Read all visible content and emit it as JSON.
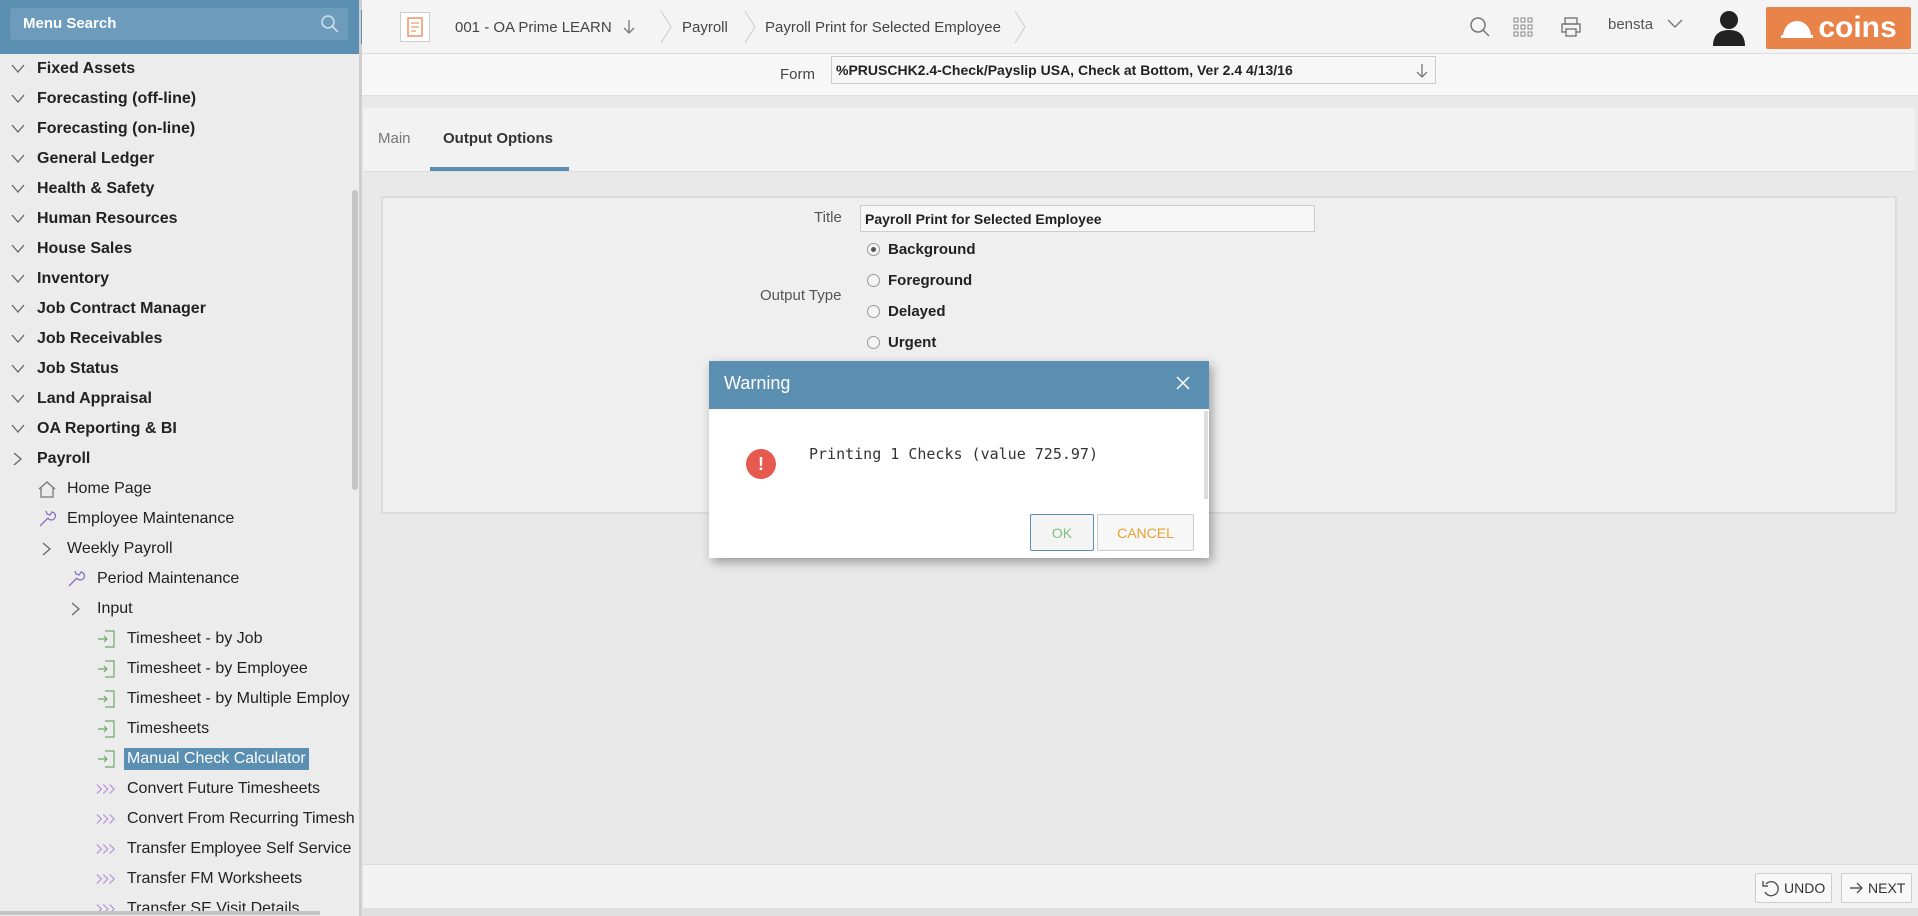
{
  "sidebar": {
    "search_label": "Menu Search",
    "items": [
      {
        "label": "Fixed Assets",
        "level": 0,
        "icon": "chevron-down"
      },
      {
        "label": "Forecasting (off-line)",
        "level": 0,
        "icon": "chevron-down"
      },
      {
        "label": "Forecasting (on-line)",
        "level": 0,
        "icon": "chevron-down"
      },
      {
        "label": "General Ledger",
        "level": 0,
        "icon": "chevron-down"
      },
      {
        "label": "Health & Safety",
        "level": 0,
        "icon": "chevron-down"
      },
      {
        "label": "Human Resources",
        "level": 0,
        "icon": "chevron-down"
      },
      {
        "label": "House Sales",
        "level": 0,
        "icon": "chevron-down"
      },
      {
        "label": "Inventory",
        "level": 0,
        "icon": "chevron-down"
      },
      {
        "label": "Job Contract Manager",
        "level": 0,
        "icon": "chevron-down"
      },
      {
        "label": "Job Receivables",
        "level": 0,
        "icon": "chevron-down"
      },
      {
        "label": "Job Status",
        "level": 0,
        "icon": "chevron-down"
      },
      {
        "label": "Land Appraisal",
        "level": 0,
        "icon": "chevron-down"
      },
      {
        "label": "OA Reporting & BI",
        "level": 0,
        "icon": "chevron-down"
      },
      {
        "label": "Payroll",
        "level": 0,
        "icon": "chevron-right"
      },
      {
        "label": "Home Page",
        "level": 1,
        "icon": "home"
      },
      {
        "label": "Employee Maintenance",
        "level": 1,
        "icon": "wrench"
      },
      {
        "label": "Weekly Payroll",
        "level": 1,
        "icon": "chevron-right"
      },
      {
        "label": "Period Maintenance",
        "level": 2,
        "icon": "wrench"
      },
      {
        "label": "Input",
        "level": 2,
        "icon": "chevron-right"
      },
      {
        "label": "Timesheet - by Job",
        "level": 3,
        "icon": "form"
      },
      {
        "label": "Timesheet - by Employee",
        "level": 3,
        "icon": "form"
      },
      {
        "label": "Timesheet - by Multiple Employ",
        "level": 3,
        "icon": "form"
      },
      {
        "label": "Timesheets",
        "level": 3,
        "icon": "form"
      },
      {
        "label": "Manual Check Calculator",
        "level": 3,
        "icon": "form",
        "selected": true
      },
      {
        "label": "Convert Future Timesheets",
        "level": 3,
        "icon": "process"
      },
      {
        "label": "Convert From Recurring Timesh",
        "level": 3,
        "icon": "process"
      },
      {
        "label": "Transfer Employee Self Service",
        "level": 3,
        "icon": "process"
      },
      {
        "label": "Transfer FM Worksheets",
        "level": 3,
        "icon": "process"
      },
      {
        "label": "Transfer SE Visit Details",
        "level": 3,
        "icon": "process"
      }
    ]
  },
  "topbar": {
    "company": "001 - OA Prime LEARN",
    "module": "Payroll",
    "page": "Payroll Print for Selected Employee",
    "username": "bensta",
    "logo_text": "coins",
    "accent_color": "#5a8fb2",
    "logo_color": "#e8834a"
  },
  "form": {
    "label": "Form",
    "value": "%PRUSCHK2.4-Check/Payslip USA, Check at Bottom, Ver 2.4 4/13/16"
  },
  "tabs": [
    {
      "label": "Main",
      "active": false
    },
    {
      "label": "Output Options",
      "active": true
    }
  ],
  "output_options": {
    "title_label": "Title",
    "title_value": "Payroll Print for Selected Employee",
    "output_type_label": "Output Type",
    "options": [
      {
        "label": "Background",
        "checked": true
      },
      {
        "label": "Foreground",
        "checked": false
      },
      {
        "label": "Delayed",
        "checked": false
      },
      {
        "label": "Urgent",
        "checked": false
      }
    ]
  },
  "dialog": {
    "title": "Warning",
    "message": "Printing 1 Checks (value 725.97)",
    "ok_label": "OK",
    "cancel_label": "CANCEL"
  },
  "footer": {
    "undo_label": "UNDO",
    "next_label": "NEXT"
  }
}
